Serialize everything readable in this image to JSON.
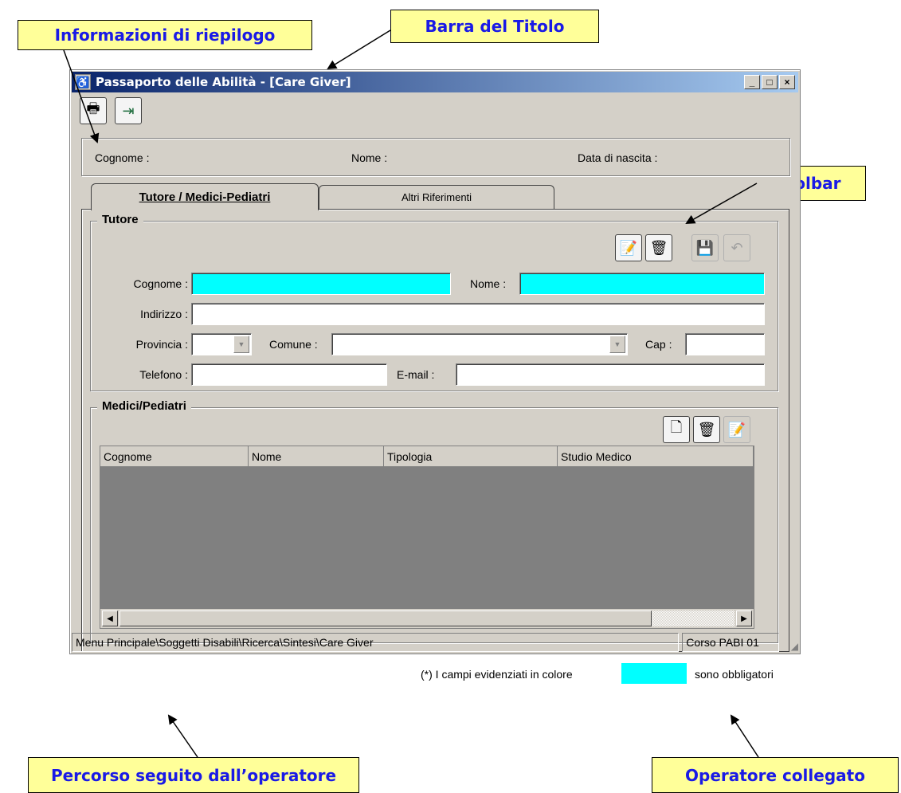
{
  "callouts": {
    "riepilogo": "Informazioni di riepilogo",
    "titolo": "Barra del Titolo",
    "toolbar": "Toolbar",
    "percorso": "Percorso seguito dall’operatore",
    "operatore": "Operatore collegato"
  },
  "window": {
    "title": "Passaporto delle Abilità - [Care Giver]",
    "minimize": "_",
    "maximize": "□",
    "close": "×"
  },
  "summary": {
    "cognome_label": "Cognome :",
    "nome_label": "Nome :",
    "data_label": "Data di nascita :"
  },
  "tabs": [
    {
      "label": "Tutore / Medici-Pediatri",
      "active": true
    },
    {
      "label": "Altri Riferimenti",
      "active": false
    }
  ],
  "tutore": {
    "title": "Tutore",
    "cognome_label": "Cognome :",
    "nome_label": "Nome :",
    "indirizzo_label": "Indirizzo :",
    "provincia_label": "Provincia :",
    "comune_label": "Comune :",
    "cap_label": "Cap :",
    "telefono_label": "Telefono :",
    "email_label": "E-mail :"
  },
  "medici": {
    "title": "Medici/Pediatri",
    "columns": [
      "Cognome",
      "Nome",
      "Tipologia",
      "Studio Medico"
    ]
  },
  "footer": {
    "note_prefix": "(*) I campi evidenziati in colore",
    "note_suffix": "sono obbligatori"
  },
  "statusbar": {
    "path": "Menu Principale\\Soggetti Disabili\\Ricerca\\Sintesi\\Care Giver",
    "operator": "Corso PABI 01"
  },
  "colors": {
    "required": "#00ffff",
    "callout_bg": "#ffff99",
    "callout_text": "#1a1ae6",
    "titlebar": "#0a246a"
  }
}
